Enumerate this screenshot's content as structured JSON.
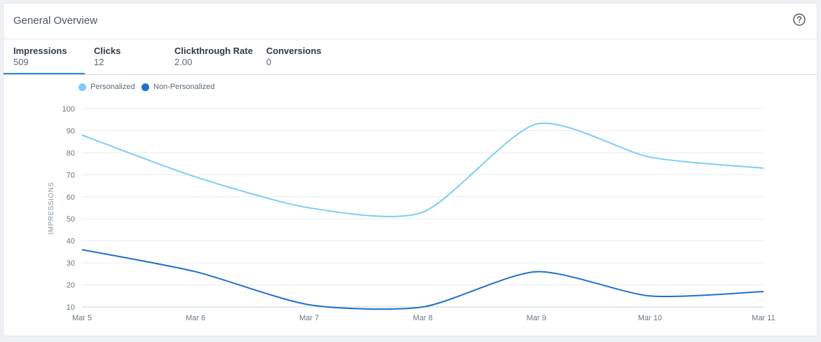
{
  "header": {
    "title": "General Overview",
    "help_icon": "question-circle-icon"
  },
  "tabs": [
    {
      "label": "Impressions",
      "value": "509",
      "active": true
    },
    {
      "label": "Clicks",
      "value": "12",
      "active": false
    },
    {
      "label": "Clickthrough Rate",
      "value": "2.00",
      "active": false
    },
    {
      "label": "Conversions",
      "value": "0",
      "active": false
    }
  ],
  "colors": {
    "personalized": "#7ecdf6",
    "non_personalized": "#1e6fd0",
    "active_tab": "#2b8bd6"
  },
  "chart_data": {
    "type": "line",
    "categories": [
      "Mar 5",
      "Mar 6",
      "Mar 7",
      "Mar 8",
      "Mar 9",
      "Mar 10",
      "Mar 11"
    ],
    "series": [
      {
        "name": "Personalized",
        "values": [
          88,
          69,
          55,
          53,
          93,
          78,
          73
        ]
      },
      {
        "name": "Non-Personalized",
        "values": [
          36,
          26,
          11,
          10,
          26,
          15,
          17
        ]
      }
    ],
    "ylabel": "IMPRESSIONS",
    "ylim": [
      10,
      100
    ],
    "yticks": [
      "10",
      "20",
      "30",
      "40",
      "50",
      "60",
      "70",
      "80",
      "90",
      "100"
    ],
    "grid": true,
    "legend_position": "top-left"
  }
}
